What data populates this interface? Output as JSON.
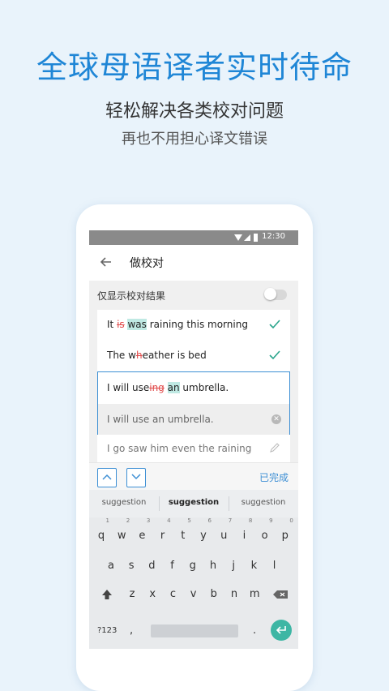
{
  "promo": {
    "headline": "全球母语译者实时待命",
    "subtitle": "轻松解决各类校对问题",
    "subtitle2": "再也不用担心译文错误"
  },
  "status_bar": {
    "time": "12:30"
  },
  "app_bar": {
    "title": "做校对"
  },
  "filter": {
    "label": "仅显示校对结果",
    "enabled": false
  },
  "sentences": [
    {
      "parts": [
        {
          "t": "It ",
          "s": "n"
        },
        {
          "t": "is",
          "s": "del"
        },
        {
          "t": " ",
          "s": "n"
        },
        {
          "t": "was",
          "s": "ins"
        },
        {
          "t": " raining this morning",
          "s": "n"
        }
      ],
      "status": "checked"
    },
    {
      "parts": [
        {
          "t": "The w",
          "s": "n"
        },
        {
          "t": "h",
          "s": "del"
        },
        {
          "t": "eather is bed",
          "s": "n"
        }
      ],
      "status": "checked"
    },
    {
      "parts": [
        {
          "t": "I will use",
          "s": "n"
        },
        {
          "t": "ing",
          "s": "del"
        },
        {
          "t": " ",
          "s": "n"
        },
        {
          "t": "an",
          "s": "ins"
        },
        {
          "t": " umbrella.",
          "s": "n"
        }
      ],
      "status": "editing",
      "edit_value": "I will use an umbrella."
    },
    {
      "text": "I go saw him even the raining",
      "status": "pending"
    }
  ],
  "nav": {
    "done_label": "已完成"
  },
  "keyboard": {
    "suggestions": [
      "suggestion",
      "suggestion",
      "suggestion"
    ],
    "row1": [
      {
        "k": "q",
        "n": "1"
      },
      {
        "k": "w",
        "n": "2"
      },
      {
        "k": "e",
        "n": "3"
      },
      {
        "k": "r",
        "n": "4"
      },
      {
        "k": "t",
        "n": "5"
      },
      {
        "k": "y",
        "n": "6"
      },
      {
        "k": "u",
        "n": "7"
      },
      {
        "k": "i",
        "n": "8"
      },
      {
        "k": "o",
        "n": "9"
      },
      {
        "k": "p",
        "n": "0"
      }
    ],
    "row2": [
      "a",
      "s",
      "d",
      "f",
      "g",
      "h",
      "j",
      "k",
      "l"
    ],
    "row3": [
      "z",
      "x",
      "c",
      "v",
      "b",
      "n",
      "m"
    ],
    "symbols_label": "?123",
    "comma": ",",
    "period": "."
  },
  "colors": {
    "accent": "#1f86d6",
    "strike": "#e14a4a",
    "insert_highlight": "#bfe9e3",
    "check": "#2aa58c"
  }
}
